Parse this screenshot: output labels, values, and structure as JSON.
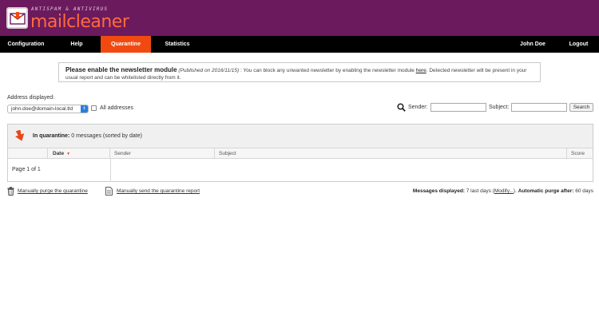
{
  "brand": {
    "tagline": "ANTISPAM & ANTIVIRUS",
    "name": "mailcleaner",
    "accent_color": "#f04a10",
    "header_color": "#6c1a5e"
  },
  "nav": {
    "configuration": "Configuration",
    "help": "Help",
    "quarantine": "Quarantine",
    "statistics": "Statistics",
    "user": "John Doe",
    "logout": "Logout"
  },
  "notice": {
    "title": "Please enable the newsletter module",
    "published": "(Published on 2016/11/15)",
    "body_before_link": " : You can block any unwanted newsletter by enabling the newsletter module ",
    "link": "here",
    "body_after_link": ". Detected newsletter will be present in your usual report and can be whitelisted directly from it."
  },
  "address": {
    "label": "Address displayed:",
    "selected": "john.doe@domain-local.tld",
    "all_addresses_label": "All addresses"
  },
  "search": {
    "sender_label": "Sender:",
    "subject_label": "Subject:",
    "button": "Search"
  },
  "quarantine": {
    "heading_label": "In quarantine:",
    "heading_value": "0 messages (sorted by date)",
    "columns": [
      "Date",
      "Sender",
      "Subject",
      "Score"
    ],
    "page_info": "Page 1 of 1"
  },
  "footer": {
    "purge_link": "Manually purge the quarantine",
    "report_link": "Manually send the quarantine report",
    "messages_displayed_label": "Messages displayed:",
    "messages_displayed_value": "7 last days",
    "modify_link": "Modify...",
    "auto_purge_label": "Automatic purge after:",
    "auto_purge_value": "60 days"
  }
}
